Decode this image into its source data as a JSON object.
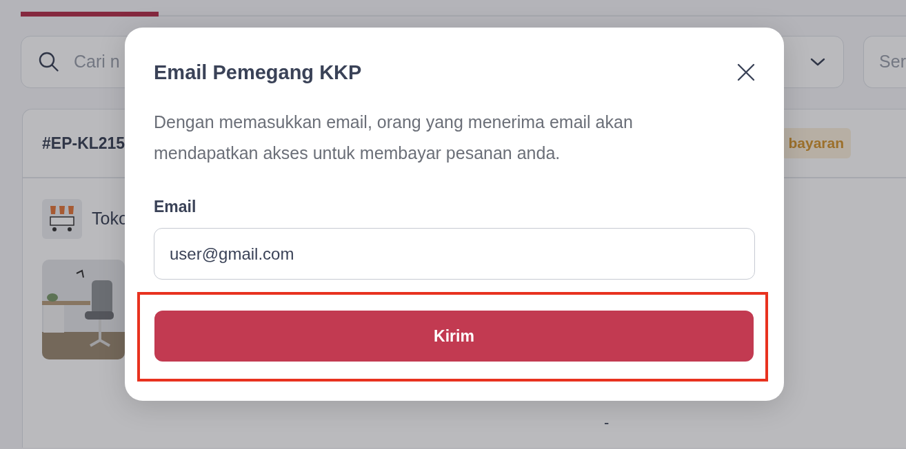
{
  "page": {
    "search": {
      "placeholder": "Cari n"
    },
    "filter_field": {
      "placeholder": "Ser"
    },
    "order": {
      "id": "#EP-KL215",
      "status": "bayaran",
      "store": "Toko",
      "price": "-"
    }
  },
  "modal": {
    "title": "Email Pemegang KKP",
    "description": "Dengan memasukkan email, orang yang menerima email akan mendapatkan akses untuk membayar pesanan anda.",
    "email": {
      "label": "Email",
      "value": "user@gmail.com"
    },
    "submit": "Kirim",
    "highlighted": true
  }
}
